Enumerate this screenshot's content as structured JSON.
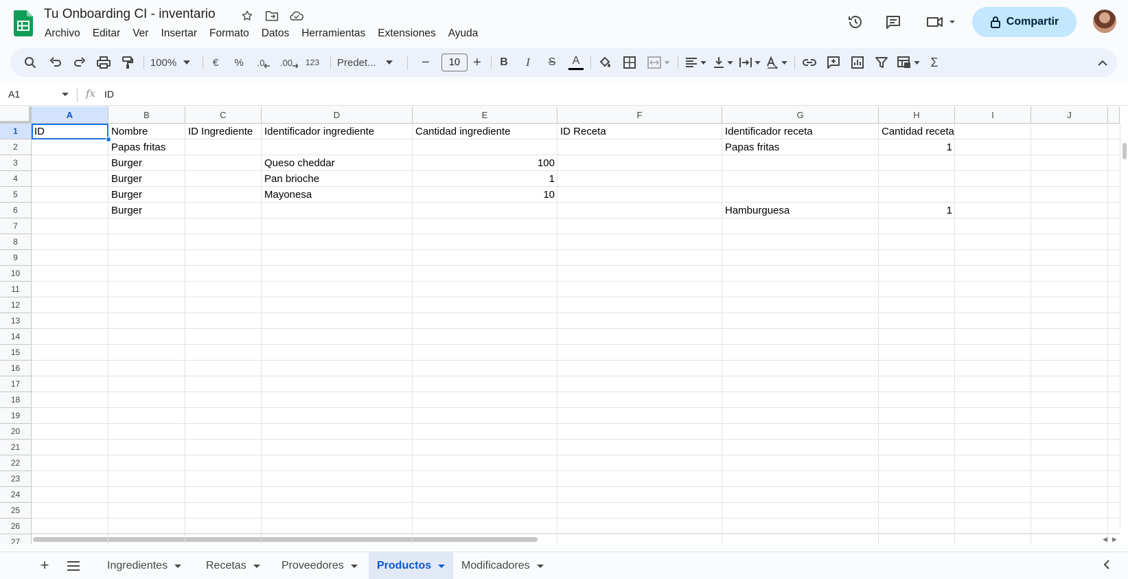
{
  "document": {
    "title": "Tu Onboarding CI - inventario"
  },
  "menu": [
    "Archivo",
    "Editar",
    "Ver",
    "Insertar",
    "Formato",
    "Datos",
    "Herramientas",
    "Extensiones",
    "Ayuda"
  ],
  "share": {
    "label": "Compartir"
  },
  "toolbar": {
    "zoom": "100%",
    "currency": "€",
    "percent": "%",
    "decrease_decimals": ".0",
    "increase_decimals": ".00",
    "more_formats": "123",
    "font": "Predet...",
    "font_size": "10",
    "minus": "−",
    "plus": "+",
    "bold": "B",
    "italic": "I",
    "strikethrough": "S",
    "text_color_glyph": "A",
    "sum": "Σ"
  },
  "formula_bar": {
    "cell_ref": "A1",
    "fx": "fx",
    "content": "ID"
  },
  "grid": {
    "columns": [
      "A",
      "B",
      "C",
      "D",
      "E",
      "F",
      "G",
      "H",
      "I",
      "J"
    ],
    "selected_column": "A",
    "rows": [
      "1",
      "2",
      "3",
      "4",
      "5",
      "6",
      "7",
      "8",
      "9",
      "10",
      "11",
      "12",
      "13",
      "14",
      "15",
      "16",
      "17",
      "18",
      "19",
      "20",
      "21",
      "22",
      "23",
      "24",
      "25",
      "26",
      "27"
    ],
    "selected_row": "1",
    "cells": [
      {
        "col": 0,
        "row": 0,
        "value": "ID"
      },
      {
        "col": 1,
        "row": 0,
        "value": "Nombre"
      },
      {
        "col": 2,
        "row": 0,
        "value": "ID Ingrediente"
      },
      {
        "col": 3,
        "row": 0,
        "value": "Identificador ingrediente"
      },
      {
        "col": 4,
        "row": 0,
        "value": "Cantidad ingrediente"
      },
      {
        "col": 5,
        "row": 0,
        "value": "ID Receta"
      },
      {
        "col": 6,
        "row": 0,
        "value": "Identificador receta"
      },
      {
        "col": 7,
        "row": 0,
        "value": "Cantidad receta"
      },
      {
        "col": 1,
        "row": 1,
        "value": "Papas fritas"
      },
      {
        "col": 6,
        "row": 1,
        "value": "Papas fritas"
      },
      {
        "col": 7,
        "row": 1,
        "value": "1",
        "num": true
      },
      {
        "col": 1,
        "row": 2,
        "value": "Burger"
      },
      {
        "col": 3,
        "row": 2,
        "value": "Queso cheddar"
      },
      {
        "col": 4,
        "row": 2,
        "value": "100",
        "num": true
      },
      {
        "col": 1,
        "row": 3,
        "value": "Burger"
      },
      {
        "col": 3,
        "row": 3,
        "value": "Pan brioche"
      },
      {
        "col": 4,
        "row": 3,
        "value": "1",
        "num": true
      },
      {
        "col": 1,
        "row": 4,
        "value": "Burger"
      },
      {
        "col": 3,
        "row": 4,
        "value": "Mayonesa"
      },
      {
        "col": 4,
        "row": 4,
        "value": "10",
        "num": true
      },
      {
        "col": 1,
        "row": 5,
        "value": "Burger"
      },
      {
        "col": 6,
        "row": 5,
        "value": "Hamburguesa"
      },
      {
        "col": 7,
        "row": 5,
        "value": "1",
        "num": true
      }
    ]
  },
  "sheets": [
    {
      "label": "Ingredientes",
      "active": false
    },
    {
      "label": "Recetas",
      "active": false
    },
    {
      "label": "Proveedores",
      "active": false
    },
    {
      "label": "Productos",
      "active": true
    },
    {
      "label": "Modificadores",
      "active": false
    }
  ],
  "colors": {
    "accent": "#0b57d0",
    "selection": "#1a73e8",
    "share_bg": "#c2e7ff",
    "sheets_green": "#0f9d58"
  }
}
